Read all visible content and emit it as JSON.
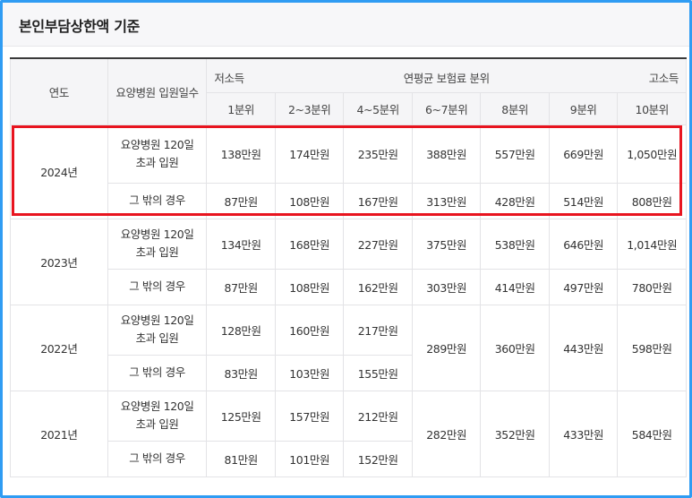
{
  "title": "본인부담상한액 기준",
  "headers": {
    "year": "연도",
    "days": "요양병원 입원일수",
    "low": "저소득",
    "mid": "연평균 보험료 분위",
    "high": "고소득",
    "deciles": [
      "1분위",
      "2~3분위",
      "4~5분위",
      "6~7분위",
      "8분위",
      "9분위",
      "10분위"
    ]
  },
  "categories": {
    "over120_line1": "요양병원 120일",
    "over120_line2": "초과 입원",
    "other": "그 밖의 경우"
  },
  "years": [
    {
      "year": "2024년",
      "over120": [
        "138만원",
        "174만원",
        "235만원",
        "388만원",
        "557만원",
        "669만원",
        "1,050만원"
      ],
      "other": [
        "87만원",
        "108만원",
        "167만원",
        "313만원",
        "428만원",
        "514만원",
        "808만원"
      ]
    },
    {
      "year": "2023년",
      "over120": [
        "134만원",
        "168만원",
        "227만원",
        "375만원",
        "538만원",
        "646만원",
        "1,014만원"
      ],
      "other": [
        "87만원",
        "108만원",
        "162만원",
        "303만원",
        "414만원",
        "497만원",
        "780만원"
      ]
    },
    {
      "year": "2022년",
      "over120": [
        "128만원",
        "160만원",
        "217만원"
      ],
      "other": [
        "83만원",
        "103만원",
        "155만원"
      ],
      "shared": [
        "289만원",
        "360만원",
        "443만원",
        "598만원"
      ]
    },
    {
      "year": "2021년",
      "over120": [
        "125만원",
        "157만원",
        "212만원"
      ],
      "other": [
        "81만원",
        "101만원",
        "152만원"
      ],
      "shared": [
        "282만원",
        "352만원",
        "433만원",
        "584만원"
      ]
    }
  ],
  "colors": {
    "frame_border": "#2f9cf3",
    "highlight_border": "#e8141f",
    "header_bg": "#f5f5f7"
  }
}
